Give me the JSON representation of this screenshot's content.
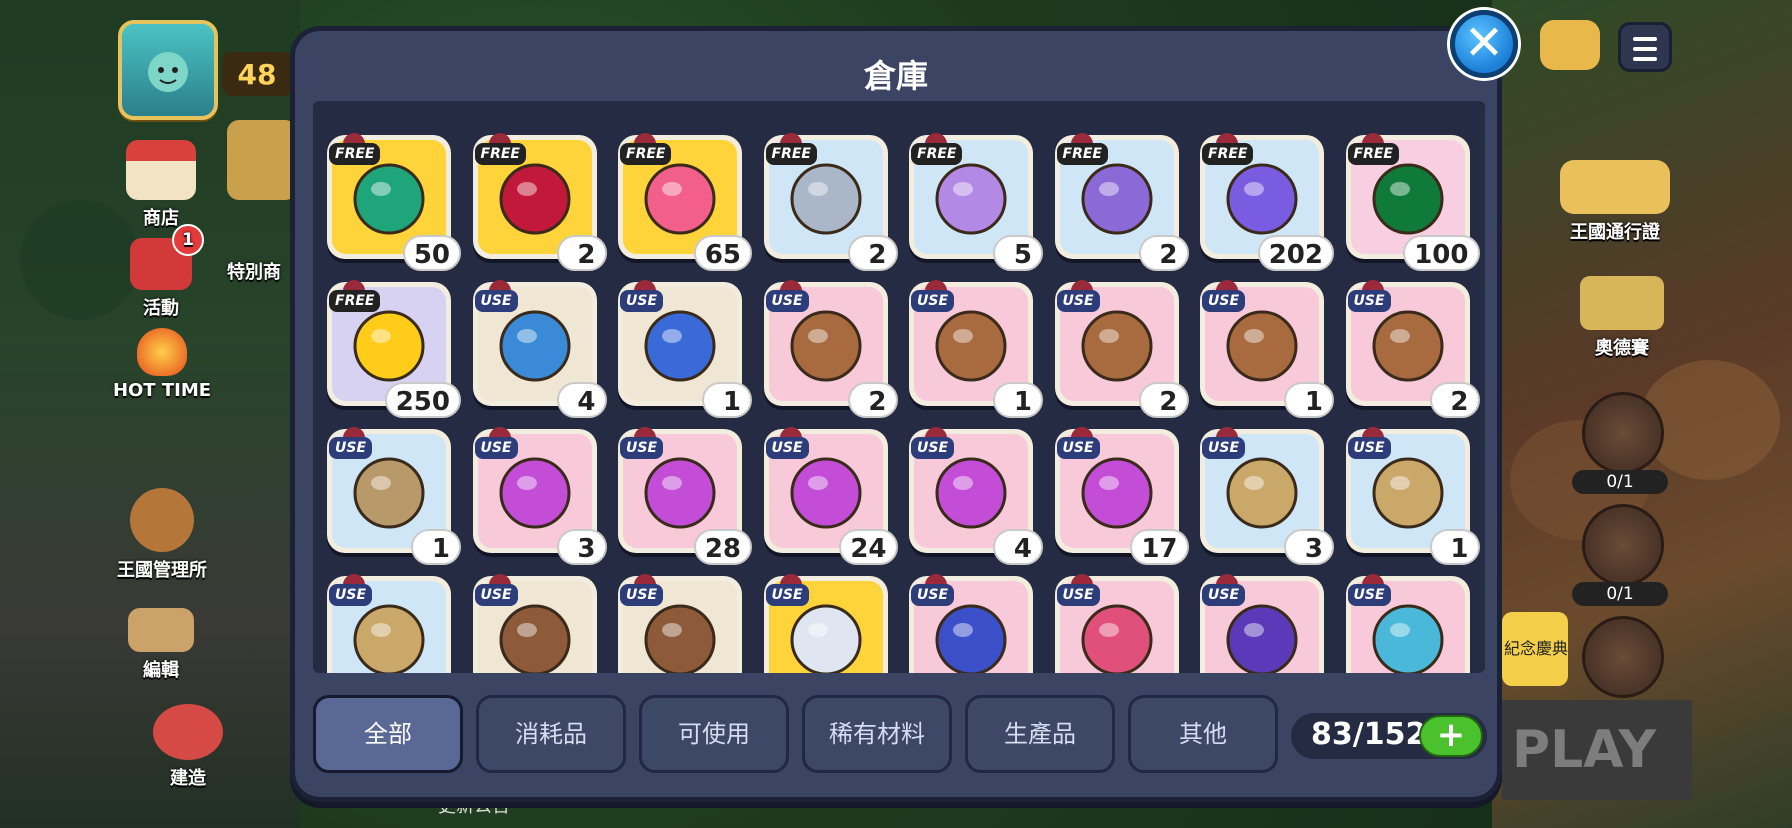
{
  "header": {
    "title": "倉庫",
    "level": "48"
  },
  "left_menu": [
    {
      "label": "商店",
      "icon": "shop-icon"
    },
    {
      "label": "活動",
      "icon": "event-gift-icon",
      "badge": "1"
    },
    {
      "label": "特別商",
      "icon": "special-shop-icon"
    },
    {
      "label": "HOT TIME",
      "icon": "hot-time-flame-icon"
    },
    {
      "label": "王國管理所",
      "icon": "kingdom-management-icon"
    },
    {
      "label": "編輯",
      "icon": "edit-blocks-icon"
    },
    {
      "label": "建造",
      "icon": "build-icon"
    }
  ],
  "right_menu": [
    {
      "label": "王國通行證",
      "icon": "kingdom-pass-icon"
    },
    {
      "label": "奧德賽",
      "icon": "odyssey-feather-icon"
    },
    {
      "label": "0/1",
      "icon": "house-action-icon"
    },
    {
      "label": "0/1",
      "icon": "sword-action-icon"
    }
  ],
  "right_extra": {
    "banner": "紀念慶典",
    "play": "PLAY"
  },
  "bottom_hint": "更新公告",
  "items": [
    {
      "tag": "FREE",
      "count": "50",
      "bg": "#ffd43a",
      "icon": "green-crystal-potion-icon"
    },
    {
      "tag": "FREE",
      "count": "2",
      "bg": "#ffd43a",
      "icon": "jelly-heart-icon"
    },
    {
      "tag": "FREE",
      "count": "65",
      "bg": "#ffd43a",
      "icon": "bear-coin-icon"
    },
    {
      "tag": "FREE",
      "count": "2",
      "bg": "#cfe6f6",
      "icon": "silver-cookie-cutter-icon"
    },
    {
      "tag": "FREE",
      "count": "5",
      "bg": "#cfe6f6",
      "icon": "purple-cookie-cutter-icon"
    },
    {
      "tag": "FREE",
      "count": "2",
      "bg": "#cfe6f6",
      "icon": "purple-book-icon"
    },
    {
      "tag": "FREE",
      "count": "202",
      "bg": "#cfe6f6",
      "icon": "purple-flower-crystal-icon"
    },
    {
      "tag": "FREE",
      "count": "100",
      "bg": "#f7cfe0",
      "icon": "emerald-gem-icon"
    },
    {
      "tag": "FREE",
      "count": "250",
      "bg": "#d7d2f2",
      "icon": "rainbow-star-icon"
    },
    {
      "tag": "USE",
      "count": "4",
      "bg": "#efe6d4",
      "icon": "level50-boost-icon"
    },
    {
      "tag": "USE",
      "count": "1",
      "bg": "#efe6d4",
      "icon": "level60-boost-icon"
    },
    {
      "tag": "USE",
      "count": "2",
      "bg": "#f8c9d8",
      "icon": "treasure-chest-icon"
    },
    {
      "tag": "USE",
      "count": "1",
      "bg": "#f8c9d8",
      "icon": "treasure-chest-icon"
    },
    {
      "tag": "USE",
      "count": "2",
      "bg": "#f8c9d8",
      "icon": "treasure-chest-icon"
    },
    {
      "tag": "USE",
      "count": "1",
      "bg": "#f8c9d8",
      "icon": "treasure-chest-icon"
    },
    {
      "tag": "USE",
      "count": "2",
      "bg": "#f8c9d8",
      "icon": "treasure-chest-icon"
    },
    {
      "tag": "USE",
      "count": "1",
      "bg": "#cfe6f6",
      "icon": "cross-chest-icon"
    },
    {
      "tag": "USE",
      "count": "3",
      "bg": "#f8c9d8",
      "icon": "purple-gem-chest-icon"
    },
    {
      "tag": "USE",
      "count": "28",
      "bg": "#f8c9d8",
      "icon": "purple-gem-chest-icon"
    },
    {
      "tag": "USE",
      "count": "24",
      "bg": "#f8c9d8",
      "icon": "purple-gem-chest-icon"
    },
    {
      "tag": "USE",
      "count": "4",
      "bg": "#f8c9d8",
      "icon": "purple-gem-chest-icon"
    },
    {
      "tag": "USE",
      "count": "17",
      "bg": "#f8c9d8",
      "icon": "purple-gem-chest-icon"
    },
    {
      "tag": "USE",
      "count": "3",
      "bg": "#cfe6f6",
      "icon": "gold-pouch-chest-icon"
    },
    {
      "tag": "USE",
      "count": "1",
      "bg": "#cfe6f6",
      "icon": "gold-pouch-chest-icon"
    },
    {
      "tag": "USE",
      "count": "",
      "bg": "#cfe6f6",
      "icon": "gold-pouch-chest-icon"
    },
    {
      "tag": "USE",
      "count": "",
      "bg": "#efe6d4",
      "icon": "brown-pouch-chest-icon"
    },
    {
      "tag": "USE",
      "count": "",
      "bg": "#efe6d4",
      "icon": "brown-pouch-chest-icon"
    },
    {
      "tag": "USE",
      "count": "",
      "bg": "#ffd43a",
      "icon": "costume-shirt-icon"
    },
    {
      "tag": "USE",
      "count": "",
      "bg": "#f8c9d8",
      "icon": "moon-card-icon"
    },
    {
      "tag": "USE",
      "count": "",
      "bg": "#f8c9d8",
      "icon": "candy-card-icon"
    },
    {
      "tag": "USE",
      "count": "",
      "bg": "#f8c9d8",
      "icon": "leaf-card-icon"
    },
    {
      "tag": "USE",
      "count": "",
      "bg": "#f8c9d8",
      "icon": "sparkle-card-icon"
    }
  ],
  "tabs": [
    {
      "label": "全部",
      "active": true
    },
    {
      "label": "消耗品",
      "active": false
    },
    {
      "label": "可使用",
      "active": false
    },
    {
      "label": "稀有材料",
      "active": false
    },
    {
      "label": "生產品",
      "active": false
    },
    {
      "label": "其他",
      "active": false
    }
  ],
  "storage": {
    "text": "83/152",
    "plus": "+"
  },
  "colors": {
    "panel": "#3b4462",
    "grid_bg": "#252b42",
    "accent_green": "#4bc12d",
    "close_blue": "#1b7fd8"
  }
}
